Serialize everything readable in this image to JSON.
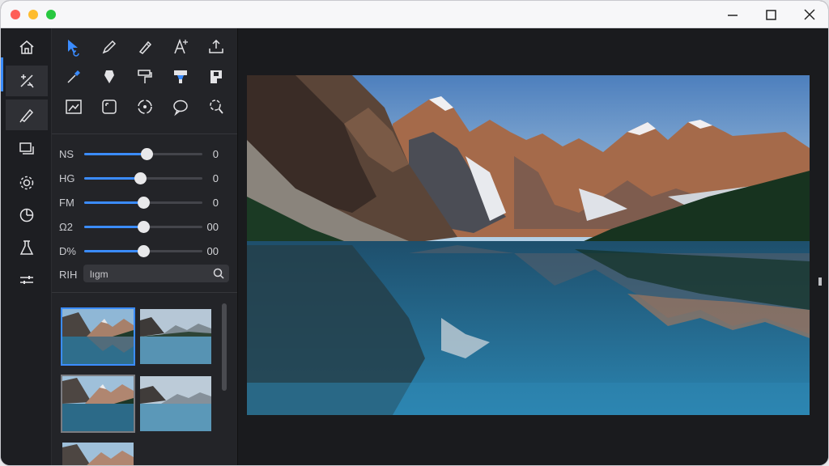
{
  "window": {
    "controls": [
      "close",
      "minimize",
      "maximize"
    ]
  },
  "rail": {
    "items": [
      {
        "name": "home-icon"
      },
      {
        "name": "adjust-icon",
        "active": true
      },
      {
        "name": "brush-icon"
      },
      {
        "name": "layers-icon"
      },
      {
        "name": "settings-icon"
      },
      {
        "name": "chart-icon"
      },
      {
        "name": "flask-icon"
      },
      {
        "name": "sliders-icon"
      }
    ]
  },
  "tools": {
    "rows": [
      [
        "select-icon",
        "pen-icon",
        "pencil-icon",
        "text-icon",
        "export-icon"
      ],
      [
        "eyedropper-icon",
        "shield-icon",
        "paint-roller-icon",
        "fill-icon",
        "stamp-icon"
      ],
      [
        "crop-icon",
        "frame-icon",
        "rotate-icon",
        "speech-bubble-icon",
        "lasso-icon"
      ]
    ]
  },
  "adjustments": {
    "sliders": [
      {
        "label": "NS",
        "value": "0",
        "level": 0.53
      },
      {
        "label": "HG",
        "value": "0",
        "level": 0.47
      },
      {
        "label": "FM",
        "value": "0",
        "level": 0.5
      },
      {
        "label": "Ω2",
        "value": "00",
        "level": 0.5
      },
      {
        "label": "D%",
        "value": "00",
        "level": 0.5
      }
    ]
  },
  "search": {
    "label": "RIH",
    "placeholder": "lıgm"
  },
  "colors": {
    "accent": "#3b8cff",
    "panel": "#232428",
    "background": "#1a1b1e"
  }
}
